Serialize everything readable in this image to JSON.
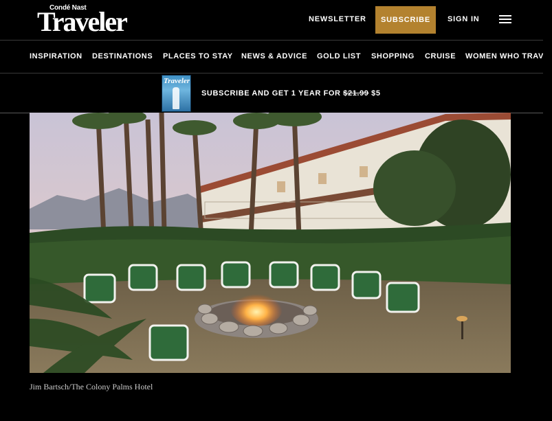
{
  "header": {
    "logo_small": "Condé Nast",
    "logo_big": "Traveler",
    "newsletter_label": "NEWSLETTER",
    "subscribe_label": "SUBSCRIBE",
    "signin_label": "SIGN IN",
    "subscribe_color": "#b3822f"
  },
  "nav": {
    "items": [
      "INSPIRATION",
      "DESTINATIONS",
      "PLACES TO STAY",
      "NEWS & ADVICE",
      "GOLD LIST",
      "SHOPPING",
      "CRUISE",
      "WOMEN WHO TRAVEL"
    ]
  },
  "promo": {
    "cover_title": "Traveler",
    "text_prefix": "SUBSCRIBE AND GET 1 YEAR FOR ",
    "old_price": "$21.99",
    "new_price": "$5"
  },
  "article": {
    "caption": "Jim Bartsch/The Colony Palms Hotel"
  }
}
